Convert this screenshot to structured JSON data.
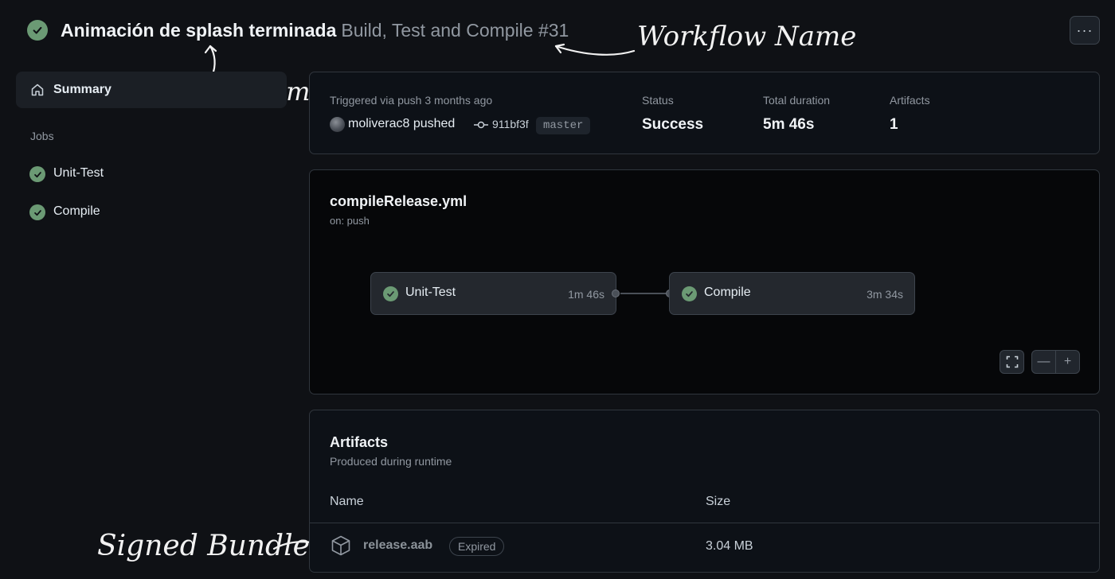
{
  "header": {
    "commit_title": "Animación de splash terminada",
    "workflow_run": "Build, Test and Compile #31",
    "more_glyph": "···"
  },
  "annotations": {
    "workflow_name": "Workflow Name",
    "latest_commit": "Latest commit",
    "signed_bundle": "Signed Bundle"
  },
  "sidebar": {
    "summary_label": "Summary",
    "jobs_heading": "Jobs",
    "jobs": [
      {
        "label": "Unit-Test",
        "status": "success"
      },
      {
        "label": "Compile",
        "status": "success"
      }
    ]
  },
  "summary": {
    "trigger_text": "Triggered via push 3 months ago",
    "actor": "moliverac8",
    "action": "pushed",
    "commit_sha": "911bf3f",
    "branch": "master",
    "status_label": "Status",
    "status_value": "Success",
    "duration_label": "Total duration",
    "duration_value": "5m 46s",
    "artifacts_label": "Artifacts",
    "artifacts_value": "1"
  },
  "graph": {
    "file": "compileRelease.yml",
    "trigger": "on: push",
    "jobs": [
      {
        "name": "Unit-Test",
        "duration": "1m 46s",
        "status": "success"
      },
      {
        "name": "Compile",
        "duration": "3m 34s",
        "status": "success"
      }
    ],
    "zoom_out_glyph": "—",
    "zoom_in_glyph": "+"
  },
  "artifacts": {
    "title": "Artifacts",
    "subtitle": "Produced during runtime",
    "col_name": "Name",
    "col_size": "Size",
    "items": [
      {
        "name": "release.aab",
        "badge": "Expired",
        "size": "3.04 MB"
      }
    ]
  },
  "colors": {
    "background": "#0f1115",
    "success": "#6b9a74",
    "border": "#30363d",
    "muted_text": "#9198a1"
  },
  "icons": [
    "check-circle-icon",
    "kebab-menu-icon",
    "home-icon",
    "git-commit-icon",
    "fullscreen-icon",
    "package-icon"
  ]
}
